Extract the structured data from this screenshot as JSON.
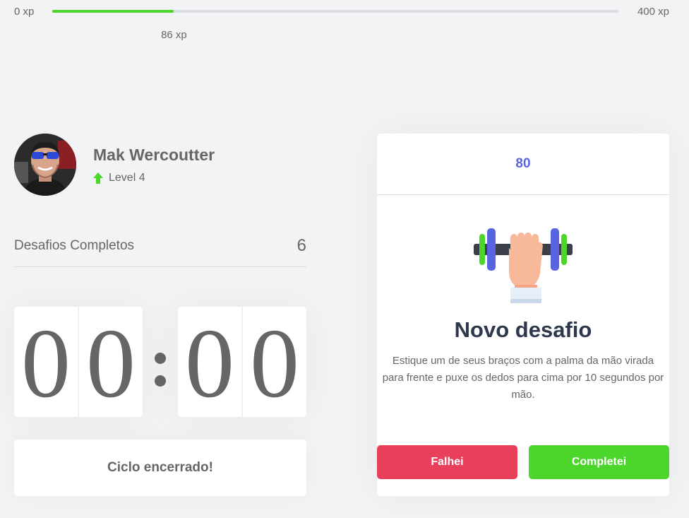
{
  "xp": {
    "min_label": "0 xp",
    "max_label": "400 xp",
    "current_label": "86 xp",
    "current": 86,
    "max": 400,
    "fill_color": "#4cd62b"
  },
  "profile": {
    "name": "Mak Wercoutter",
    "level_label": "Level 4",
    "level_icon": "level-up-arrow-icon"
  },
  "completed": {
    "label": "Desafios Completos",
    "count": "6"
  },
  "countdown": {
    "minute_left": "0",
    "minute_right": "0",
    "second_left": "0",
    "second_right": "0"
  },
  "cycle_button_label": "Ciclo encerrado!",
  "challenge": {
    "amount": "80",
    "icon": "dumbbell-hand-icon",
    "title": "Novo desafio",
    "description": "Estique um de seus braços com a palma da mão virada para frente e puxe os dedos para cima por 10 segundos por mão.",
    "fail_label": "Falhei",
    "done_label": "Completei"
  },
  "colors": {
    "background": "#f2f3f5",
    "green": "#4cd62b",
    "red": "#e83f5b",
    "blue": "#5965e0",
    "title": "#2e384d"
  }
}
